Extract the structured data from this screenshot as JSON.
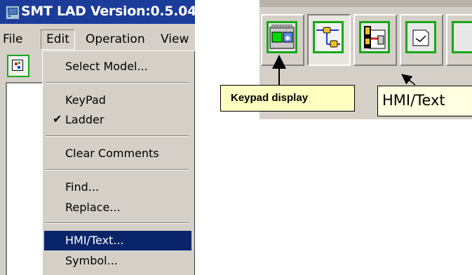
{
  "window": {
    "title": "SMT LAD Version:0.5.04"
  },
  "menubar": {
    "items": [
      {
        "label": "File"
      },
      {
        "label": "Edit"
      },
      {
        "label": "Operation"
      },
      {
        "label": "View"
      }
    ]
  },
  "edit_menu": {
    "items": [
      {
        "label": "Select Model..."
      },
      {
        "label": "KeyPad"
      },
      {
        "label": "Ladder",
        "checked": true
      },
      {
        "label": "Clear Comments"
      },
      {
        "label": "Find..."
      },
      {
        "label": "Replace..."
      },
      {
        "label": "HMI/Text...",
        "selected": true
      },
      {
        "label": "Symbol..."
      }
    ]
  },
  "toolbar_zoom": {
    "buttons": [
      {
        "icon": "keypad-display-icon"
      },
      {
        "icon": "ladder-icon",
        "pressed": true
      },
      {
        "icon": "hmi-text-icon"
      },
      {
        "icon": "function-block-icon"
      }
    ],
    "tooltip": "HMI/Text"
  },
  "callout": {
    "label": "Keypad display"
  },
  "colors": {
    "title_bar": "#1c3c9a",
    "selection": "#0a246a",
    "button_frame_green": "#18a818",
    "face": "#d4d0c8",
    "tooltip_bg": "#ffffe1",
    "callout_bg": "#ffffbf"
  }
}
